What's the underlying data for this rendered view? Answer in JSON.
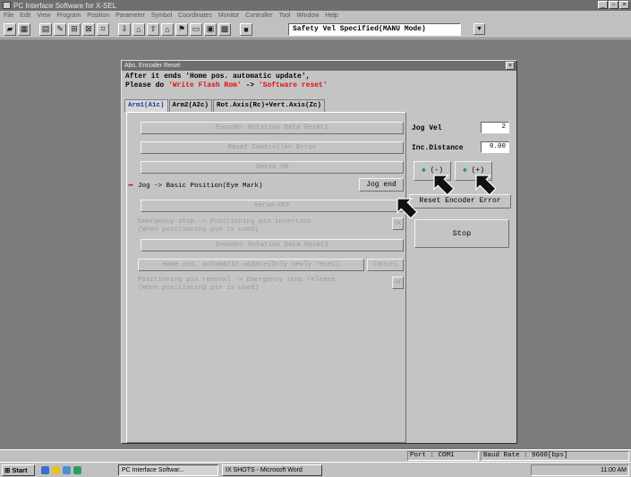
{
  "app": {
    "title": "PC Interface Software for X-SEL",
    "menu": [
      "File",
      "Edit",
      "View",
      "Program",
      "Position",
      "Parameter",
      "Symbol",
      "Coordinates",
      "Monitor",
      "Controller",
      "Tool",
      "Window",
      "Help"
    ],
    "mode_select": "Safety Vel Specified(MANU Mode)"
  },
  "dialog": {
    "title": "Abs. Encoder Reset",
    "msg_line1": "After it ends 'Home pos. automatic update',",
    "msg_line2_prefix": "Please do ",
    "msg_line2_a": "'Write Flash Rom'",
    "msg_line2_arrow": " -> ",
    "msg_line2_b": "'Software reset'",
    "tabs": [
      "Arm1(A1c)",
      "Arm2(A2c)",
      "Rot.Axis(Rc)+Vert.Axis(Zc)"
    ],
    "steps": {
      "enc_rot_reset_1": "Encoder Rotation Data Reset1",
      "reset_ctrl_error": "Reset Controller Error",
      "servo_on": "Servo ON",
      "jog_basic": "Jog -> Basic Position(Eye Mark)",
      "jog_end": "Jog end",
      "servo_off": "Servo-OFF",
      "estop_line1": "Emergency stop -> Positioning pin insertion",
      "estop_line2": "(When positioning pin is used)",
      "ok_label": "OK",
      "enc_rot_reset_2": "Encoder Rotation Data Reset2",
      "home_update": "Home pos. automatic update(Only newly reset)",
      "cancel": "Cancel",
      "pin_removal_line1": "Positioning pin removal -> Emergency stop release",
      "pin_removal_line2": "(When positioning pin is used)"
    },
    "right": {
      "jog_vel_label": "Jog Vel",
      "jog_vel_value": "2",
      "inc_dist_label": "Inc.Distance",
      "inc_dist_value": "0.00",
      "jog_minus": "(-)",
      "jog_plus": "(+)",
      "reset_enc_err": "Reset Encoder Error",
      "stop": "Stop"
    }
  },
  "status": {
    "port": "Port : COM1",
    "baud": "Baud Rate : 9600[bps]"
  },
  "taskbar": {
    "start": "Start",
    "tasks": [
      "PC Interface Softwar...",
      "IX SHOTS - Microsoft Word"
    ],
    "clock": "11:00 AM"
  },
  "colors": {
    "accent_red": "#e01010",
    "tab_active": "#1a3ea0",
    "arrow_green": "#20a040"
  }
}
